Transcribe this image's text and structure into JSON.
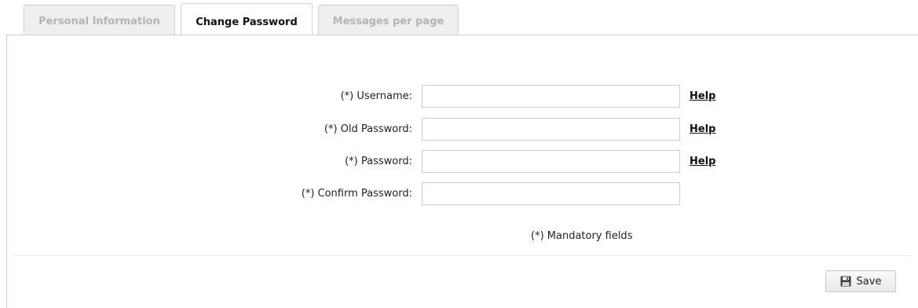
{
  "tabs": [
    {
      "label": "Personal Information",
      "active": false
    },
    {
      "label": "Change Password",
      "active": true
    },
    {
      "label": "Messages per page",
      "active": false
    }
  ],
  "form": {
    "fields": [
      {
        "label": "(*) Username:",
        "value": "",
        "help": "Help"
      },
      {
        "label": "(*) Old Password:",
        "value": "",
        "help": "Help"
      },
      {
        "label": "(*) Password:",
        "value": "",
        "help": "Help"
      },
      {
        "label": "(*) Confirm Password:",
        "value": ""
      }
    ],
    "mandatory_note": "(*) Mandatory fields"
  },
  "actions": {
    "save_label": "Save",
    "save_icon": "floppy-disk-icon"
  },
  "colors": {
    "tab_inactive_text": "#b4b4b4",
    "tab_inactive_bg": "#efefef",
    "border": "#cfcfcf"
  }
}
